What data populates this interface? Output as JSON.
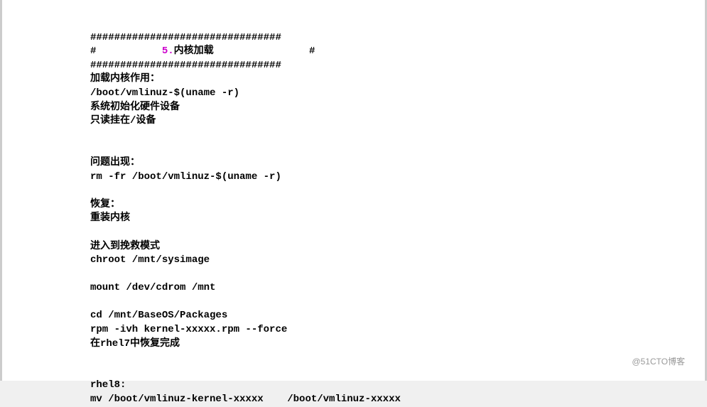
{
  "doc": {
    "border1": "################################",
    "titleline_pre": "#           ",
    "section_num": "5.",
    "title_text": "内核加载                #",
    "border2": "################################",
    "line1": "加载内核作用：",
    "line2": "/boot/vmlinuz-$(uname -r)",
    "line3": "系统初始化硬件设备",
    "line4": "只读挂在/设备",
    "blank1": "",
    "line5": "问题出现：",
    "line6": "rm -fr /boot/vmlinuz-$(uname -r)",
    "blank2": "",
    "line7": "恢复：",
    "line8": "重装内核",
    "blank3": "",
    "line9": "进入到挽救模式",
    "line10": "chroot /mnt/sysimage",
    "blank4": "",
    "line11": "mount /dev/cdrom /mnt",
    "blank5": "",
    "line12": "cd /mnt/BaseOS/Packages",
    "line13": "rpm -ivh kernel-xxxxx.rpm --force",
    "line14": "在rhel7中恢复完成",
    "blank6": "",
    "blank7": "",
    "line15": "rhel8:",
    "line16": "mv /boot/vmlinuz-kernel-xxxxx    /boot/vmlinuz-xxxxx"
  },
  "watermark": "@51CTO博客"
}
